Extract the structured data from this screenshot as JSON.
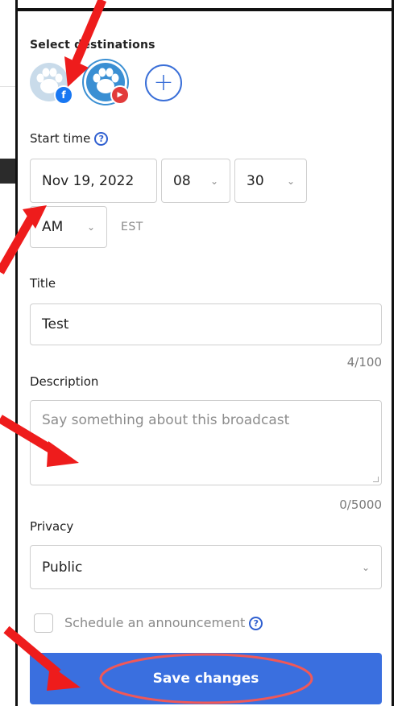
{
  "destinations": {
    "heading": "Select destinations",
    "items": [
      {
        "name": "facebook",
        "badge": "f",
        "active": false
      },
      {
        "name": "youtube",
        "badge": "▶",
        "active": true
      }
    ],
    "add_label": "+"
  },
  "start_time": {
    "label": "Start time",
    "help": "?",
    "date": "Nov 19, 2022",
    "hour": "08",
    "minute": "30",
    "ampm": "AM",
    "timezone": "EST"
  },
  "title_field": {
    "label": "Title",
    "value": "Test",
    "counter": "4/100"
  },
  "description_field": {
    "label": "Description",
    "placeholder": "Say something about this broadcast",
    "counter": "0/5000"
  },
  "privacy": {
    "label": "Privacy",
    "value": "Public"
  },
  "announcement": {
    "label": "Schedule an announcement",
    "help": "?",
    "checked": false
  },
  "save_button": {
    "label": "Save changes"
  },
  "colors": {
    "accent": "#3a6fdf",
    "annotation": "#ee1c1c",
    "youtube": "#e23b3b",
    "facebook": "#1877f2"
  },
  "icons": [
    "help-icon",
    "chevron-down-icon",
    "plus-icon",
    "facebook-icon",
    "youtube-icon",
    "paw-icon"
  ]
}
